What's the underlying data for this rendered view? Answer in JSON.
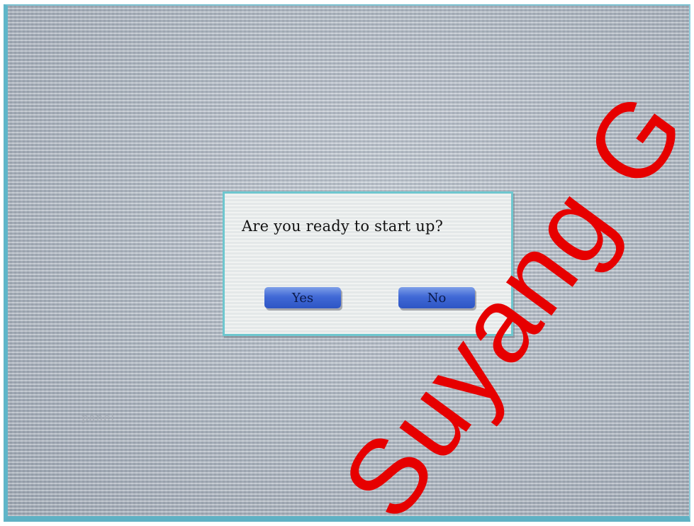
{
  "dialog": {
    "message": "Are you ready to start up?",
    "yes_label": "Yes",
    "no_label": "No"
  },
  "background_label": "panel",
  "watermark": {
    "text": "Suyang Giga",
    "color": "#e60000"
  },
  "colors": {
    "dialog_border": "#6ec7cf",
    "button": "#4169d6",
    "screen_frame": "#5fb6c9"
  }
}
